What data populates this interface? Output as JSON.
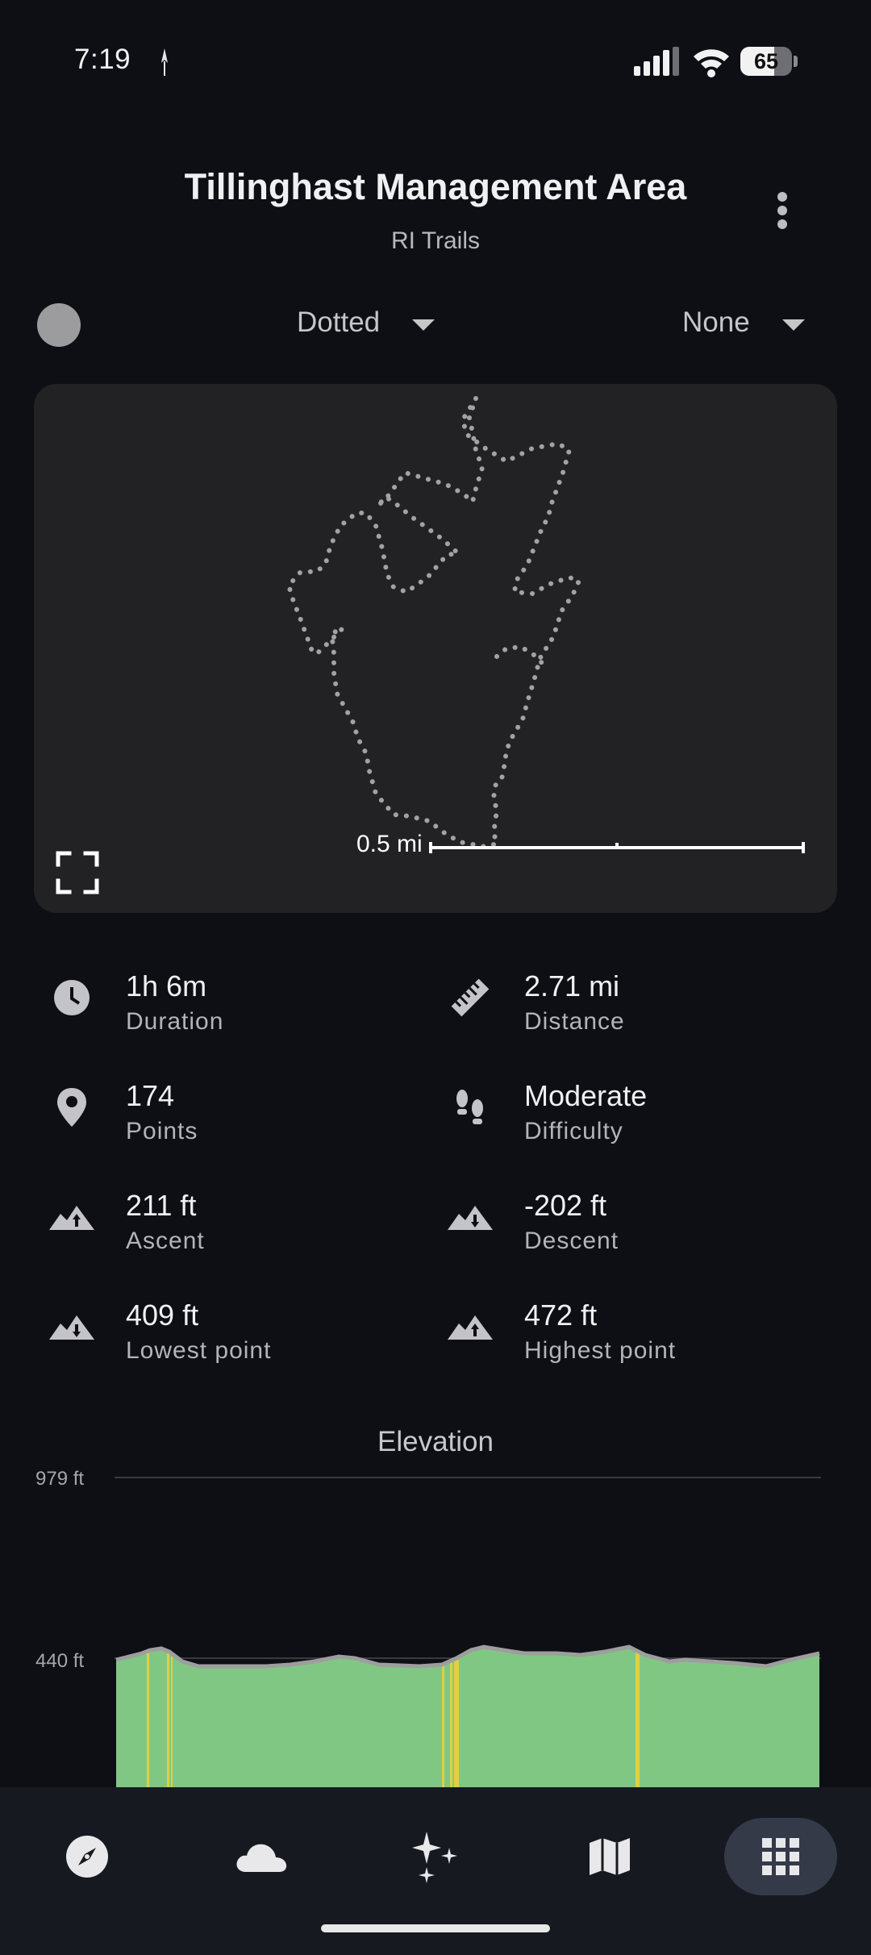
{
  "status_bar": {
    "time": "7:19",
    "battery_level": "65",
    "battery_fraction": 0.65
  },
  "header": {
    "title": "Tillinghast Management Area",
    "subtitle": "RI Trails",
    "more_icon": "more-vert-icon"
  },
  "controls": {
    "color_swatch": "#9c9c9e",
    "style_value": "Dotted",
    "overlay_value": "None"
  },
  "map": {
    "scale_label": "0.5 mi",
    "trail_color": "#a2a2a4",
    "background": "#222224"
  },
  "stats": {
    "duration": {
      "value": "1h 6m",
      "label": "Duration",
      "icon": "clock-icon"
    },
    "distance": {
      "value": "2.71 mi",
      "label": "Distance",
      "icon": "ruler-icon"
    },
    "points": {
      "value": "174",
      "label": "Points",
      "icon": "location-pin-icon"
    },
    "difficulty": {
      "value": "Moderate",
      "label": "Difficulty",
      "icon": "footprints-icon"
    },
    "ascent": {
      "value": "211 ft",
      "label": "Ascent",
      "icon": "mountain-up-icon"
    },
    "descent": {
      "value": "-202 ft",
      "label": "Descent",
      "icon": "mountain-down-icon"
    },
    "lowest": {
      "value": "409 ft",
      "label": "Lowest point",
      "icon": "mountain-down-icon"
    },
    "highest": {
      "value": "472 ft",
      "label": "Highest point",
      "icon": "mountain-up-icon"
    }
  },
  "elevation": {
    "title": "Elevation",
    "top_label": "979 ft",
    "mid_label": "440 ft",
    "fill_color": "#81c784",
    "line_color": "#9e9e9e",
    "highlight_color": "#e0d040"
  },
  "bottom_nav": {
    "items": [
      {
        "icon": "compass-icon",
        "active": false
      },
      {
        "icon": "cloud-icon",
        "active": false
      },
      {
        "icon": "sparkles-icon",
        "active": false
      },
      {
        "icon": "map-icon",
        "active": false
      },
      {
        "icon": "grid-apps-icon",
        "active": true
      }
    ]
  }
}
